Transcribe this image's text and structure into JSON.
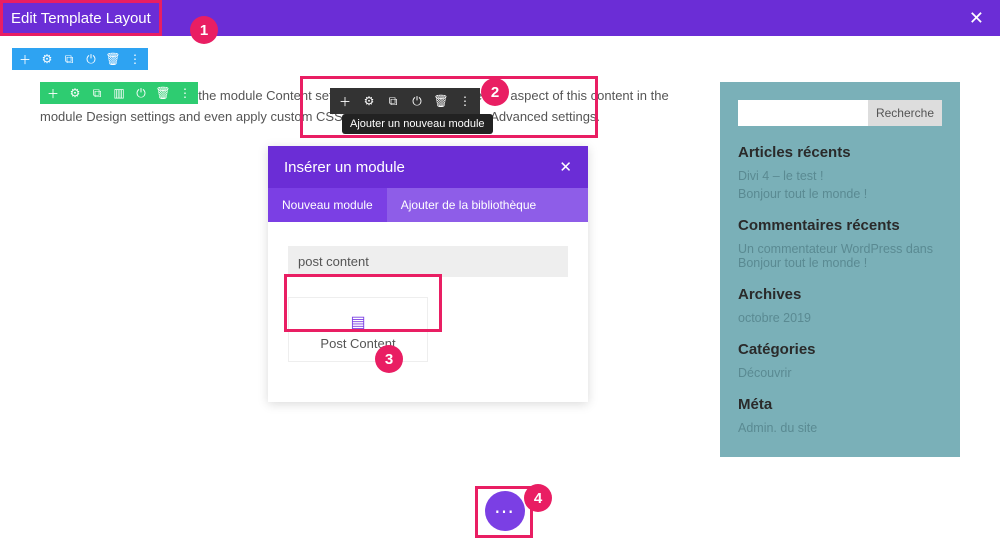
{
  "header": {
    "title": "Edit Template Layout"
  },
  "toolbars": {
    "blue": [
      "add",
      "settings",
      "duplicate",
      "power",
      "trash",
      "more"
    ],
    "green": [
      "add",
      "settings",
      "duplicate",
      "columns",
      "power",
      "trash",
      "more"
    ],
    "dark": [
      "add",
      "settings",
      "duplicate",
      "power",
      "trash",
      "more"
    ],
    "tooltip": "Ajouter un nouveau module"
  },
  "body_text": "remove this text inline or in the module Content settings. You can also style every aspect of this content in the module Design settings and even apply custom CSS to this text in the module Advanced settings.",
  "modal": {
    "title": "Insérer un module",
    "tabs": {
      "new": "Nouveau module",
      "library": "Ajouter de la bibliothèque"
    },
    "search_value": "post content",
    "result_label": "Post Content"
  },
  "sidebar": {
    "search_button": "Recherche",
    "recent_articles": {
      "heading": "Articles récents",
      "items": [
        "Divi 4 – le test !",
        "Bonjour tout le monde !"
      ]
    },
    "recent_comments": {
      "heading": "Commentaires récents",
      "items": [
        "Un commentateur WordPress dans Bonjour tout le monde !"
      ]
    },
    "archives": {
      "heading": "Archives",
      "items": [
        "octobre 2019"
      ]
    },
    "categories": {
      "heading": "Catégories",
      "items": [
        "Découvrir"
      ]
    },
    "meta": {
      "heading": "Méta",
      "items": [
        "Admin. du site"
      ]
    }
  },
  "callouts": {
    "1": "1",
    "2": "2",
    "3": "3",
    "4": "4"
  }
}
